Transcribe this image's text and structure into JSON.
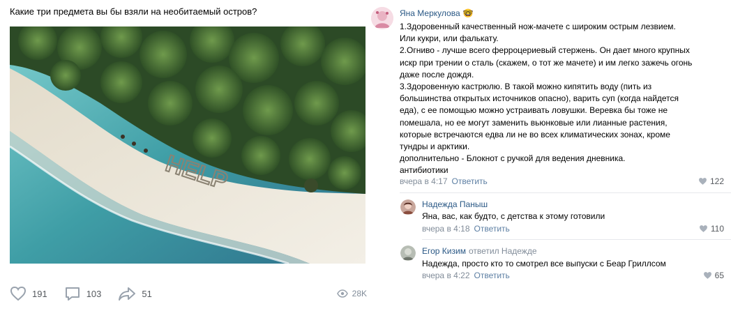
{
  "post": {
    "title": "Какие три предмета вы бы взяли на необитаемый остров?",
    "photo": {
      "icon": "photo-of-island-beach-with-help-sign",
      "sand_text": "HELP"
    },
    "actions": {
      "likes": "191",
      "comments": "103",
      "shares": "51",
      "views": "28K"
    }
  },
  "comments": [
    {
      "author": "Яна Меркулова",
      "emoji": "🤓",
      "lines": [
        "1.Здоровенный качественный нож-мачете с широким острым лезвием.",
        "Или кукри, или фалькату.",
        "2.Огниво - лучше всего ферроцериевый стержень. Он дает много крупных",
        "искр при трении о сталь (скажем, о тот же мачете) и им легко зажечь огонь",
        "даже после дождя.",
        "3.Здоровенную кастрюлю. В такой можно кипятить воду (пить из",
        "большинства открытых источников опасно), варить суп (когда найдется",
        "еда), с ее помощью можно устраивать ловушки. Веревка бы тоже не",
        "помешала, но ее могут заменить вьюнковые или лианные растения,",
        "которые встречаются едва ли не во всех климатических зонах, кроме",
        "тундры и арктики.",
        "дополнительно - Блокнот с ручкой для ведения дневника.",
        "антибиотики"
      ],
      "time": "вчера в 4:17",
      "reply_label": "Ответить",
      "likes": "122"
    },
    {
      "author": "Надежда Паныш",
      "lines": [
        "Яна, вас, как будто, с детства к этому готовили"
      ],
      "time": "вчера в 4:18",
      "reply_label": "Ответить",
      "likes": "110"
    },
    {
      "author": "Егор Кизим",
      "reply_to": "ответил Надежде",
      "lines": [
        "Надежда, просто кто то смотрел все выпуски с Беар Гриллсом"
      ],
      "time": "вчера в 4:22",
      "reply_label": "Ответить",
      "likes": "65"
    }
  ],
  "colors": {
    "link": "#2a5885",
    "meta": "#818c99",
    "reply_link": "#5d7fa3",
    "icon": "#99a2ad",
    "sea": "#3fa3a8",
    "sand": "#ede6d6",
    "jungle": "#355a2c"
  }
}
